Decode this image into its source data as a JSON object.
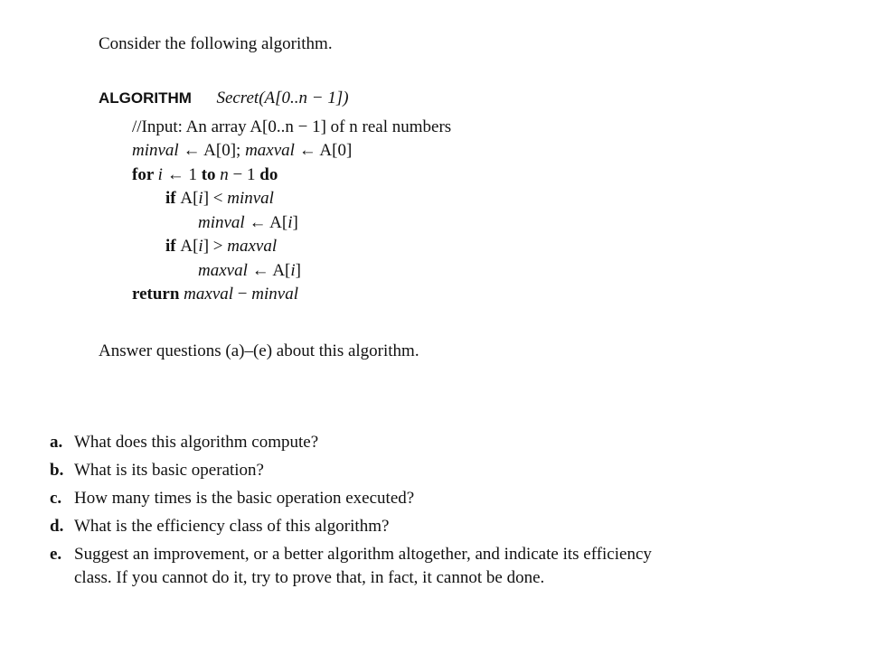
{
  "intro": "Consider the following algorithm.",
  "algorithm": {
    "keyword": "ALGORITHM",
    "signature": "Secret(A[0..n − 1])",
    "input_comment": "//Input: An array A[0..n − 1] of n real numbers",
    "lines": [
      {
        "indent": 0,
        "parts": [
          {
            "t": "minval",
            "s": "it"
          },
          {
            "t": " ← A[0]; ",
            "s": ""
          },
          {
            "t": "maxval",
            "s": "it"
          },
          {
            "t": " ← A[0]",
            "s": ""
          }
        ]
      },
      {
        "indent": 0,
        "parts": [
          {
            "t": "for ",
            "s": "kw"
          },
          {
            "t": "i",
            "s": "it"
          },
          {
            "t": " ← 1 ",
            "s": ""
          },
          {
            "t": "to ",
            "s": "kw"
          },
          {
            "t": "n",
            "s": "it"
          },
          {
            "t": " − 1 ",
            "s": ""
          },
          {
            "t": "do",
            "s": "kw"
          }
        ]
      },
      {
        "indent": 1,
        "parts": [
          {
            "t": "if ",
            "s": "kw"
          },
          {
            "t": "A[",
            "s": ""
          },
          {
            "t": "i",
            "s": "it"
          },
          {
            "t": "] < ",
            "s": ""
          },
          {
            "t": "minval",
            "s": "it"
          }
        ]
      },
      {
        "indent": 2,
        "parts": [
          {
            "t": "minval",
            "s": "it"
          },
          {
            "t": " ← A[",
            "s": ""
          },
          {
            "t": "i",
            "s": "it"
          },
          {
            "t": "]",
            "s": ""
          }
        ]
      },
      {
        "indent": 1,
        "parts": [
          {
            "t": "if ",
            "s": "kw"
          },
          {
            "t": "A[",
            "s": ""
          },
          {
            "t": "i",
            "s": "it"
          },
          {
            "t": "] > ",
            "s": ""
          },
          {
            "t": "maxval",
            "s": "it"
          }
        ]
      },
      {
        "indent": 2,
        "parts": [
          {
            "t": "maxval",
            "s": "it"
          },
          {
            "t": " ← A[",
            "s": ""
          },
          {
            "t": "i",
            "s": "it"
          },
          {
            "t": "]",
            "s": ""
          }
        ]
      },
      {
        "indent": 0,
        "parts": [
          {
            "t": "return ",
            "s": "kw"
          },
          {
            "t": "maxval",
            "s": "it"
          },
          {
            "t": " − ",
            "s": ""
          },
          {
            "t": "minval",
            "s": "it"
          }
        ]
      }
    ]
  },
  "instruction": "Answer questions (a)–(e) about this algorithm.",
  "questions": [
    {
      "label": "a.",
      "text": "What does this algorithm compute?"
    },
    {
      "label": "b.",
      "text": "What is its basic operation?"
    },
    {
      "label": "c.",
      "text": "How many times is the basic operation executed?"
    },
    {
      "label": "d.",
      "text": "What is the efficiency class of this algorithm?"
    },
    {
      "label": "e.",
      "text": "Suggest an improvement, or a better algorithm altogether, and indicate its efficiency class. If you cannot do it, try to prove that, in fact, it cannot be done."
    }
  ]
}
